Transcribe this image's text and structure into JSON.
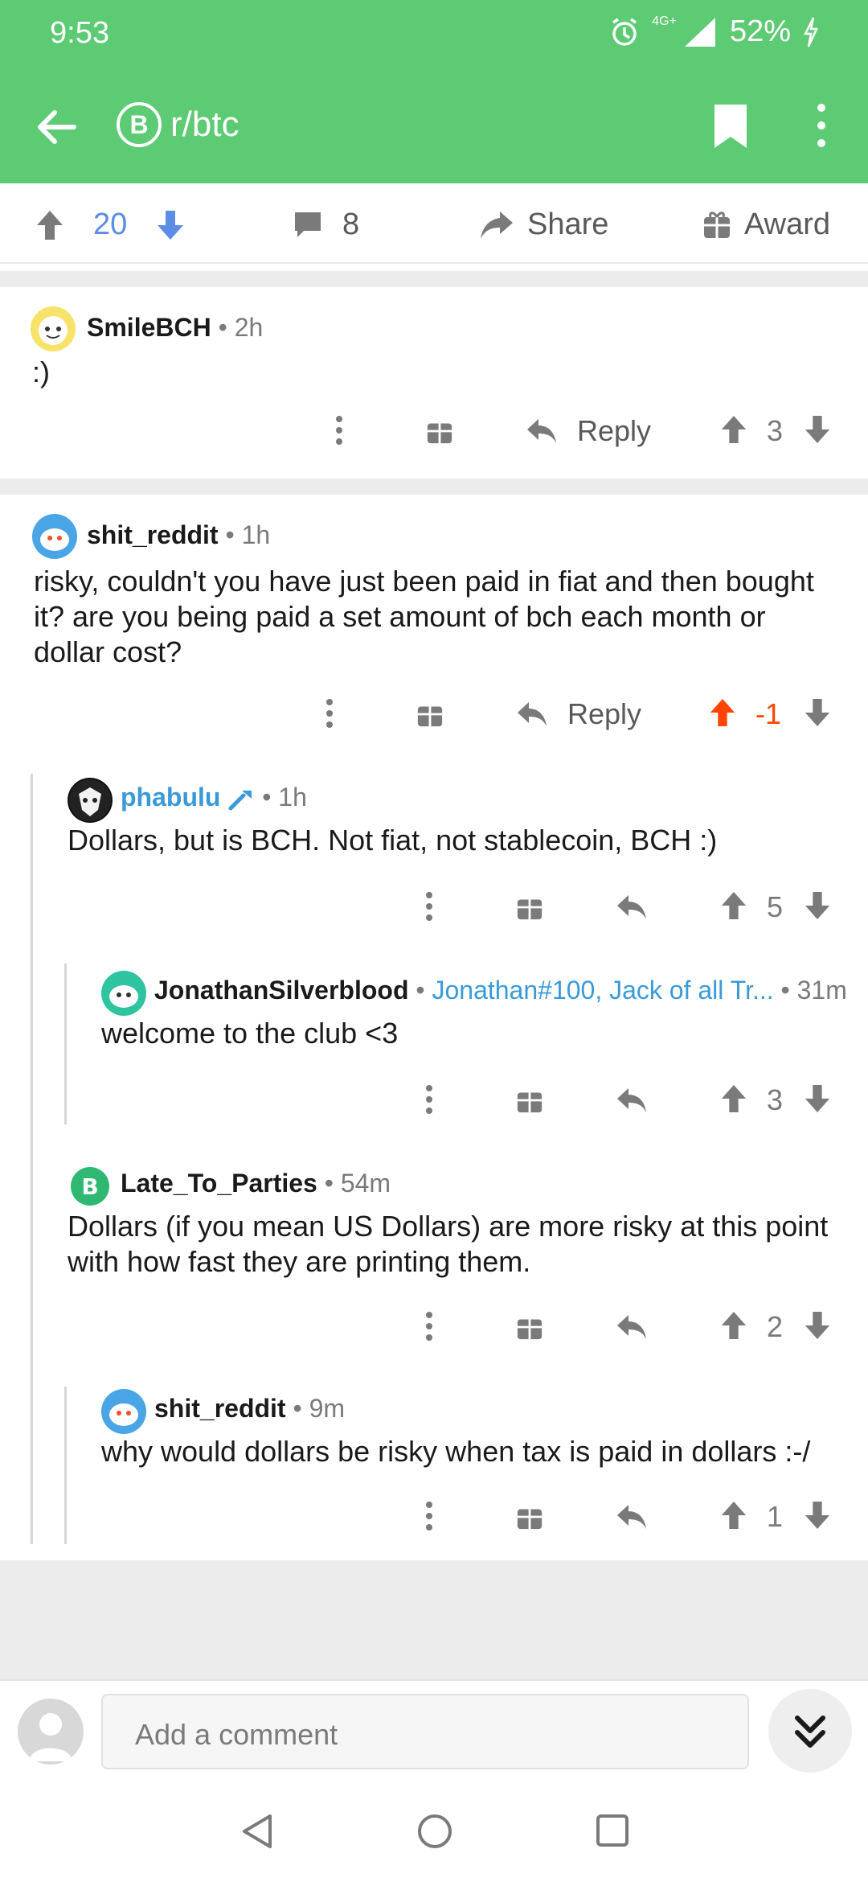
{
  "status_bar": {
    "time": "9:53",
    "network": "4G+",
    "battery": "52%"
  },
  "toolbar": {
    "subreddit": "r/btc",
    "sub_icon": "B"
  },
  "post_actions": {
    "votes": "20",
    "comments": "8",
    "share_label": "Share",
    "award_label": "Award"
  },
  "comments": [
    {
      "user": "SmileBCH",
      "time": "2h",
      "body": ":)",
      "score": "3",
      "reply_label": "Reply",
      "separator": "•"
    },
    {
      "user": "shit_reddit",
      "time": "1h",
      "body": "risky, couldn't you have just been paid in fiat and then bought it? are you being paid a set amount of bch each month or dollar cost?",
      "score": "-1",
      "reply_label": "Reply",
      "separator": "•"
    },
    {
      "user": "phabulu",
      "time": "1h",
      "body": "Dollars, but is BCH. Not fiat, not stablecoin, BCH :)",
      "score": "5",
      "separator": "•"
    },
    {
      "user": "JonathanSilverblood",
      "flair": "Jonathan#100, Jack of all Tr...",
      "time": "31m",
      "body": "welcome to the club <3",
      "score": "3",
      "separator": "•"
    },
    {
      "user": "Late_To_Parties",
      "time": "54m",
      "body": "Dollars (if you mean US Dollars) are more risky at this point with how fast they are printing them.",
      "score": "2",
      "separator": "•"
    },
    {
      "user": "shit_reddit",
      "time": "9m",
      "body": "why would dollars be risky when tax is paid in dollars :-/",
      "score": "1",
      "separator": "•"
    }
  ],
  "composer": {
    "placeholder": "Add a comment"
  },
  "colors": {
    "header": "#5dca74",
    "upvote": "#ff4500",
    "vote_blue": "#5b8de6",
    "mod_blue": "#3a9ad9"
  }
}
